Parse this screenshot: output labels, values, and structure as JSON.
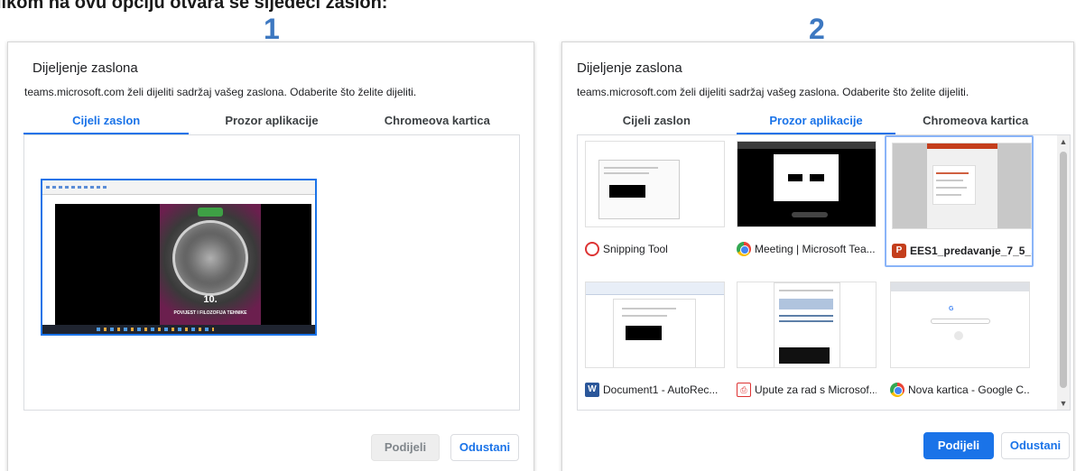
{
  "caption": "likom na ovu opciju otvara se sljedeći zaslon:",
  "steps": [
    "1",
    "2"
  ],
  "dialog1": {
    "title": "Dijeljenje zaslona",
    "subtitle": "teams.microsoft.com želi dijeliti sadržaj vašeg zaslona. Odaberite što želite dijeliti.",
    "tabs": [
      "Cijeli zaslon",
      "Prozor aplikacije",
      "Chromeova kartica"
    ],
    "active_tab": "Cijeli zaslon",
    "preview": {
      "slide_number": "10.",
      "slide_title": "POVIJEST I FILOZOFIJA TEHNIKE"
    },
    "share_label": "Podijeli",
    "cancel_label": "Odustani"
  },
  "dialog2": {
    "title": "Dijeljenje zaslona",
    "subtitle": "teams.microsoft.com želi dijeliti sadržaj vašeg zaslona. Odaberite što želite dijeliti.",
    "tabs": [
      "Cijeli zaslon",
      "Prozor aplikacije",
      "Chromeova kartica"
    ],
    "active_tab": "Prozor aplikacije",
    "windows": [
      {
        "label": "Snipping Tool",
        "icon": "snipping-tool-icon",
        "selected": false
      },
      {
        "label": "Meeting | Microsoft Tea...",
        "icon": "chrome-icon",
        "selected": false
      },
      {
        "label": "EES1_predavanje_7_5_...",
        "icon": "powerpoint-icon",
        "selected": true
      },
      {
        "label": "Document1 - AutoRec...",
        "icon": "word-icon",
        "selected": false
      },
      {
        "label": "Upute za rad s Microsof...",
        "icon": "pdf-icon",
        "selected": false
      },
      {
        "label": "Nova kartica - Google C...",
        "icon": "chrome-icon",
        "selected": false
      }
    ],
    "share_label": "Podijeli",
    "cancel_label": "Odustani"
  }
}
